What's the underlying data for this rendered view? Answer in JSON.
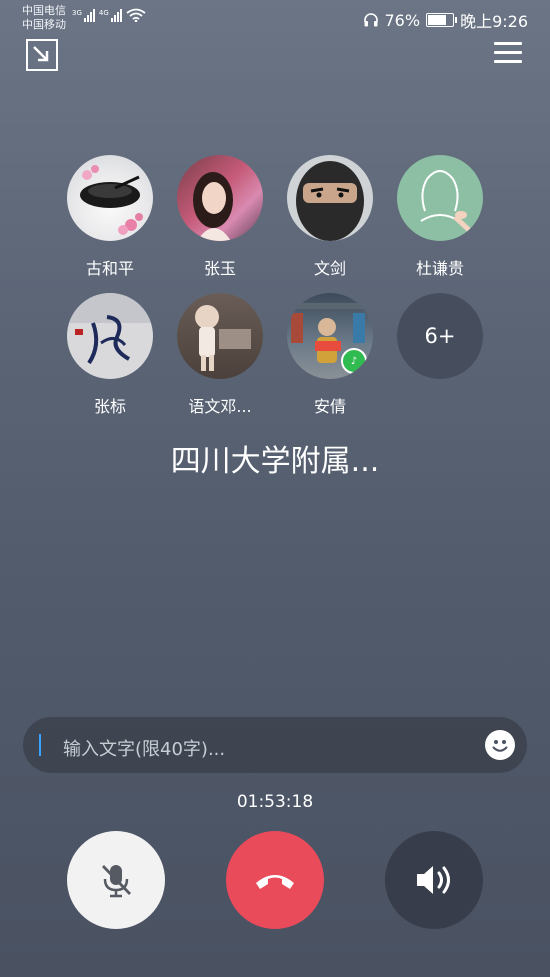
{
  "status_bar": {
    "carrier1": "中国电信",
    "carrier2": "中国移动",
    "net1": "3G",
    "net2": "4G",
    "battery": "76%",
    "battery_level": 0.76,
    "time": "晚上9:26"
  },
  "members": [
    {
      "name": "古和平",
      "avatar": "avatar-ink-bowl"
    },
    {
      "name": "张玉",
      "avatar": "avatar-woman-photo"
    },
    {
      "name": "文剑",
      "avatar": "avatar-masked-face"
    },
    {
      "name": "杜谦贵",
      "avatar": "avatar-default-penguin"
    },
    {
      "name": "张标",
      "avatar": "avatar-calligraphy"
    },
    {
      "name": "语文邓...",
      "avatar": "avatar-figurine"
    },
    {
      "name": "安倩",
      "avatar": "avatar-child-reading",
      "speaking": true
    }
  ],
  "more_count": "6+",
  "group_name": "四川大学附属...",
  "input": {
    "placeholder": "输入文字(限40字)..."
  },
  "timer": "01:53:18",
  "controls": {
    "mic": "mic-muted",
    "hangup": "hang-up",
    "speaker": "speaker-on"
  },
  "colors": {
    "hangup": "#ea4b5b",
    "speaking_badge": "#2fbb4f",
    "cursor": "#3aa2ff"
  }
}
